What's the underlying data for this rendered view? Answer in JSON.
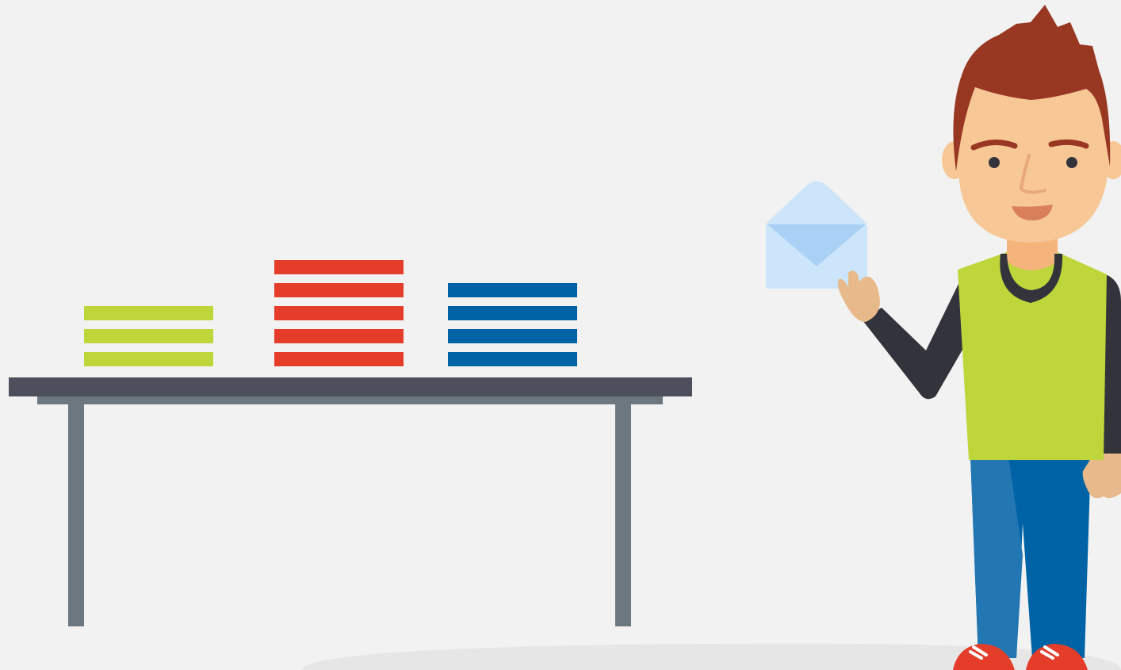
{
  "scene": {
    "background_color": "#f2f2f2",
    "floor_color": "#e6e6e6",
    "table": {
      "top_color": "#4d4f5c",
      "apron_color": "#6d7780",
      "leg_color": "#6d7780"
    },
    "stacks": [
      {
        "name": "green",
        "color": "#bed63a",
        "sheet_count": 3
      },
      {
        "name": "red",
        "color": "#e43d2a",
        "sheet_count": 5
      },
      {
        "name": "blue",
        "color": "#0063a5",
        "sheet_count": 4
      }
    ],
    "envelope": {
      "icon": "envelope-icon",
      "color": "#cde5fa",
      "flap_color": "#a9d0f5"
    },
    "person": {
      "hair_color": "#983822",
      "skin_color": "#f7c795",
      "vest_color": "#bed63a",
      "sleeve_color": "#33343b",
      "pants_color": "#0063a5",
      "pants_light_color": "#2277b3",
      "shoe_color": "#e43d2a"
    }
  }
}
